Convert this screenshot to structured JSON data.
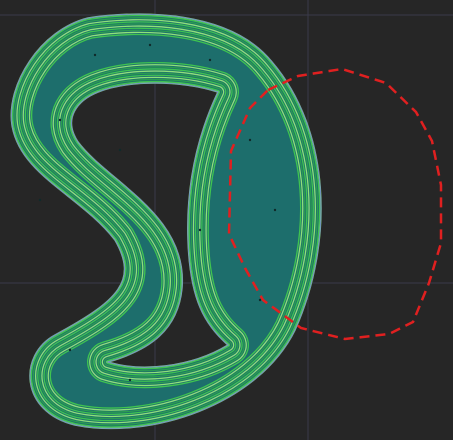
{
  "viewport": {
    "background_color": "#262626",
    "grid_color": "#3a3a4a",
    "grid": true
  },
  "toolpath": {
    "shell_count": 10,
    "fill_color": "#1d6e6c",
    "line_colors": [
      "#8fe07a",
      "#3fc450",
      "#2a9d4f",
      "#6070e0"
    ],
    "point_color": "#0f2a2a"
  },
  "overlay": {
    "shape": "dashed-polygon",
    "stroke_color": "#e02020"
  }
}
